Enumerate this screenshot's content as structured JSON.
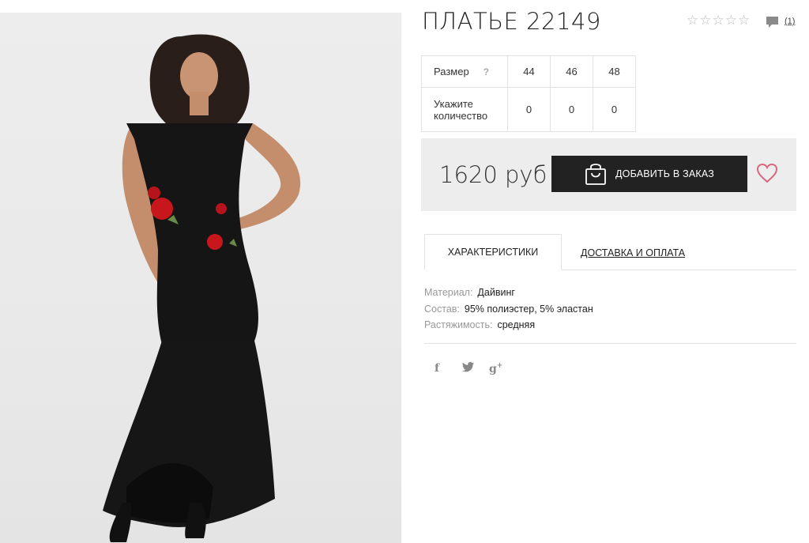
{
  "product": {
    "title": "ПЛАТЬЕ 22149",
    "rating_stars": 0,
    "review_count": "(1)"
  },
  "size_table": {
    "size_label": "Размер",
    "help": "?",
    "sizes": [
      "44",
      "46",
      "48"
    ],
    "qty_label": "Укажите количество",
    "quantities": [
      "0",
      "0",
      "0"
    ]
  },
  "buy": {
    "price": "1620 руб",
    "add_button": "ДОБАВИТЬ В ЗАКАЗ"
  },
  "tabs": {
    "active": "ХАРАКТЕРИСТИКИ",
    "delivery": "ДОСТАВКА И ОПЛАТА"
  },
  "specs": [
    {
      "key": "Материал:",
      "value": "Дайвинг"
    },
    {
      "key": "Состав:",
      "value": "95% полиэстер, 5% эластан"
    },
    {
      "key": "Растяжимость:",
      "value": "средняя"
    }
  ],
  "social": {
    "facebook": "f",
    "twitter": "🐦",
    "google": "g"
  },
  "colors": {
    "accent_heart": "#d9677e",
    "button_bg": "#222222",
    "buybox_bg": "#ededed"
  },
  "icons": [
    "star-icon",
    "comment-icon",
    "shopping-bag-icon",
    "heart-icon",
    "facebook-icon",
    "twitter-icon",
    "google-plus-icon"
  ]
}
